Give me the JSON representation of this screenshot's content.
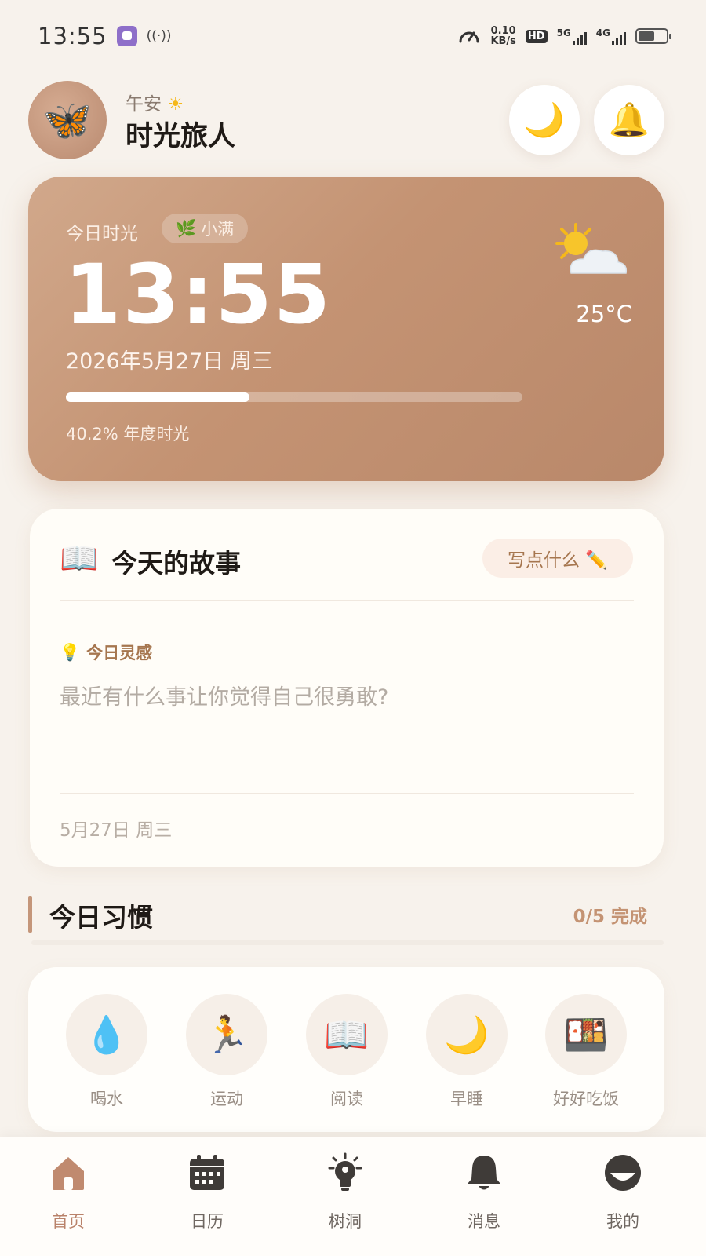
{
  "status_bar": {
    "time": "13:55",
    "speed_value": "0.10",
    "speed_unit": "KB/s",
    "hd": "HD",
    "net1": "5G",
    "net2": "4G",
    "battery_level": 0.6
  },
  "header": {
    "greeting": "午安",
    "username": "时光旅人",
    "avatar_icon": "butterfly-icon"
  },
  "time_card": {
    "label": "今日时光",
    "solar_term": "小满",
    "time": "13:55",
    "date": "2026年5月27日 周三",
    "year_progress_fraction": 0.402,
    "year_progress_text": "40.2% 年度时光",
    "weather_icon": "partly-cloudy-icon",
    "temperature": "25°C"
  },
  "story_card": {
    "title": "今天的故事",
    "write_button": "写点什么 ✏️",
    "inspiration_label": "今日灵感",
    "inspiration_prompt": "最近有什么事让你觉得自己很勇敢?",
    "date": "5月27日 周三"
  },
  "habits": {
    "title": "今日习惯",
    "progress": "0/5 完成",
    "items": [
      {
        "label": "喝水",
        "icon": "💧"
      },
      {
        "label": "运动",
        "icon": "🏃"
      },
      {
        "label": "阅读",
        "icon": "📖"
      },
      {
        "label": "早睡",
        "icon": "🌙"
      },
      {
        "label": "好好吃饭",
        "icon": "🍱"
      }
    ]
  },
  "bottom_nav": {
    "items": [
      {
        "label": "首页",
        "icon": "home-icon",
        "active": true
      },
      {
        "label": "日历",
        "icon": "calendar-icon",
        "active": false
      },
      {
        "label": "树洞",
        "icon": "lightbulb-icon",
        "active": false
      },
      {
        "label": "消息",
        "icon": "bell-icon",
        "active": false
      },
      {
        "label": "我的",
        "icon": "profile-icon",
        "active": false
      }
    ]
  },
  "colors": {
    "accent": "#c49373",
    "background": "#f7f2ec",
    "active_nav": "#b9826a"
  }
}
